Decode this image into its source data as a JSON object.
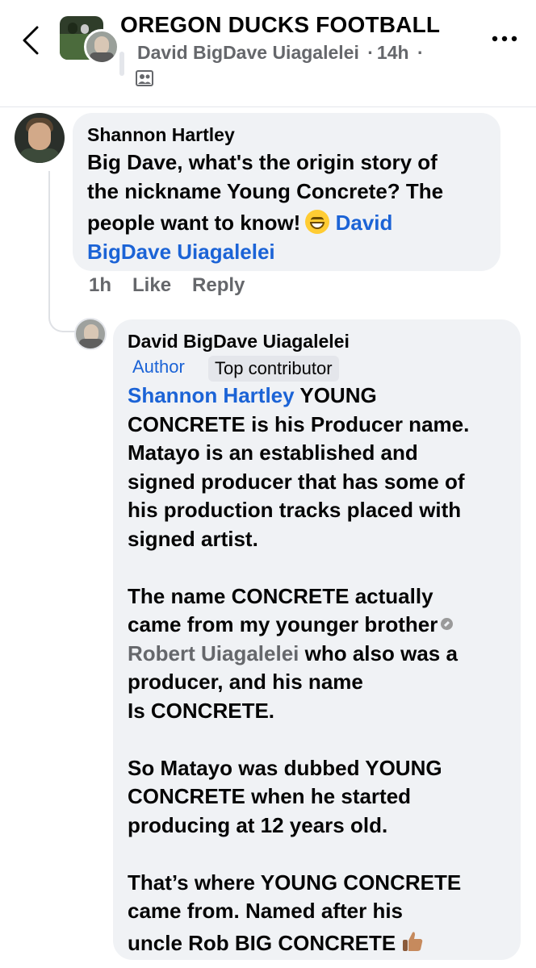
{
  "header": {
    "title": "OREGON DUCKS FOOTBALL",
    "poster": "David BigDave Uiagalelei",
    "time": "14h",
    "separator": "·"
  },
  "comment": {
    "author": "Shannon Hartley",
    "lines": [
      "Big Dave, what's the origin story of",
      "the nickname Young Concrete? The",
      "people want to know!"
    ],
    "mention_part1": "David",
    "mention_part2": "BigDave Uiagalelei",
    "time": "1h",
    "like_label": "Like",
    "reply_label": "Reply"
  },
  "reply": {
    "author": "David BigDave Uiagalelei",
    "author_badge": "Author",
    "contributor_badge": "Top contributor",
    "mention": "Shannon Hartley",
    "line1_rest": " YOUNG",
    "lines_a": [
      "CONCRETE is his Producer name.",
      "Matayo is an established and",
      "signed producer that has some of",
      "his production tracks placed with",
      "signed artist."
    ],
    "lines_b1": "The name CONCRETE actually",
    "lines_b2": "came from my younger brother",
    "profile_link": "Robert Uiagalelei",
    "lines_b3_rest": " who also was a",
    "lines_b4": "producer, and his name",
    "lines_b5": "Is CONCRETE.",
    "lines_c": [
      "So Matayo was dubbed YOUNG",
      "CONCRETE when he started",
      "producing at 12 years old."
    ],
    "lines_d": [
      "That’s where YOUNG CONCRETE",
      "came from. Named after his",
      "uncle Rob BIG CONCRETE"
    ]
  }
}
